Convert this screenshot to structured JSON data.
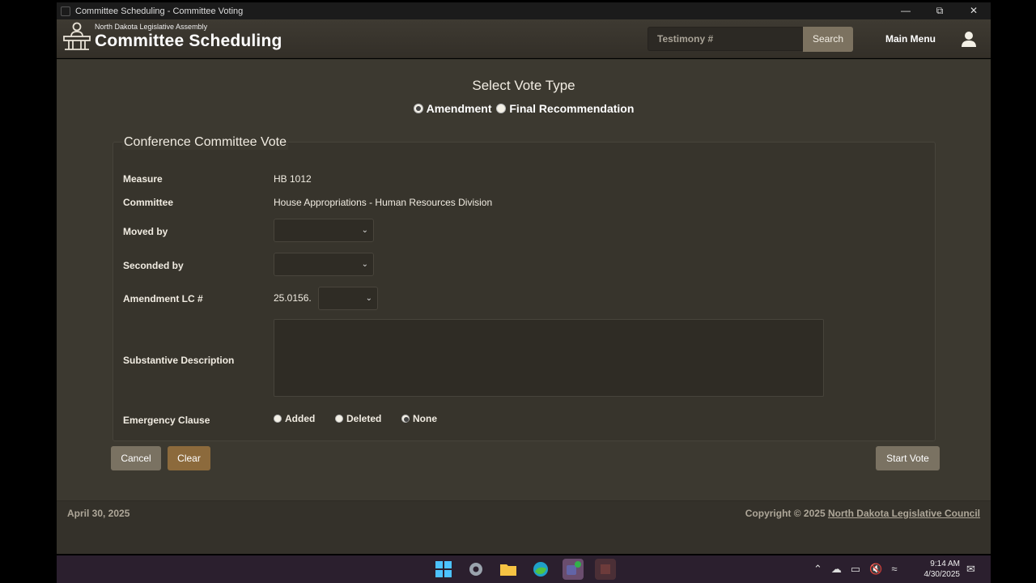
{
  "window": {
    "title": "Committee Scheduling - Committee Voting",
    "minimize": "—",
    "restore": "⧉",
    "close": "✕"
  },
  "header": {
    "org_name": "North Dakota Legislative Assembly",
    "app_name": "Committee Scheduling",
    "search_placeholder": "Testimony #",
    "search_button": "Search",
    "main_menu": "Main Menu",
    "icons": [
      "logo-podium-icon",
      "user-icon"
    ]
  },
  "vote_type": {
    "title": "Select Vote Type",
    "options": [
      {
        "label": "Amendment",
        "checked": true
      },
      {
        "label": "Final Recommendation",
        "checked": false
      }
    ]
  },
  "form": {
    "panel_title": "Conference Committee Vote",
    "measure_label": "Measure",
    "measure_value": "HB 1012",
    "committee_label": "Committee",
    "committee_value": "House Appropriations - Human Resources Division",
    "moved_by_label": "Moved by",
    "moved_by_value": "",
    "seconded_by_label": "Seconded by",
    "seconded_by_value": "",
    "amendment_label": "Amendment LC #",
    "amendment_prefix": "25.0156.",
    "amendment_value": "",
    "description_label": "Substantive Description",
    "description_value": "",
    "emergency_label": "Emergency Clause",
    "emergency_options": [
      {
        "label": "Added",
        "checked": false
      },
      {
        "label": "Deleted",
        "checked": false
      },
      {
        "label": "None",
        "checked": true
      }
    ]
  },
  "buttons": {
    "cancel": "Cancel",
    "clear": "Clear",
    "start_vote": "Start Vote"
  },
  "colors": {
    "clear_button": "#8c6a3c",
    "neutral_button": "#7a7262",
    "background": "#3c3930"
  },
  "footer": {
    "date": "April 30, 2025",
    "copyright_prefix": "Copyright © 2025 ",
    "copyright_link": "North Dakota Legislative Council"
  },
  "taskbar": {
    "time": "9:14 AM",
    "date": "4/30/2025",
    "icons": [
      "windows-start-icon",
      "settings-icon",
      "file-explorer-icon",
      "edge-browser-icon",
      "teams-icon",
      "app-icon"
    ],
    "tray_icons": [
      "chevron-up-icon",
      "onedrive-icon",
      "display-icon",
      "volume-muted-icon",
      "network-icon",
      "notification-icon"
    ]
  }
}
